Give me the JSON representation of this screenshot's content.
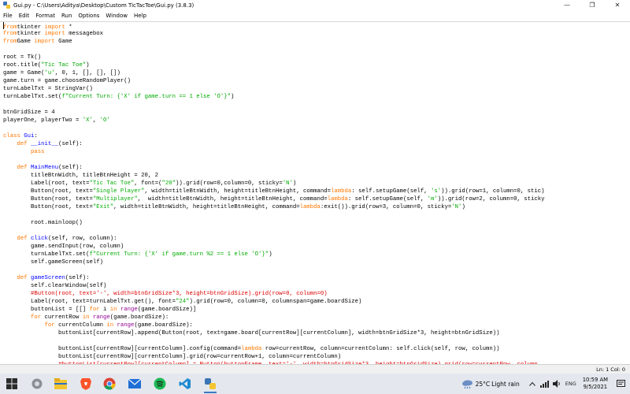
{
  "window": {
    "title": "Gui.py - C:\\Users\\Aditya\\Desktop\\Custom TicTacToe\\Gui.py (3.8.3)",
    "controls": {
      "minimize": "—",
      "maximize": "❐",
      "close": "✕"
    }
  },
  "menu": [
    "File",
    "Edit",
    "Format",
    "Run",
    "Options",
    "Window",
    "Help"
  ],
  "code_lines": [
    [
      [
        "kw",
        "from"
      ],
      [
        "",
        "tkinter "
      ],
      [
        "kw",
        "import"
      ],
      [
        "",
        " *"
      ]
    ],
    [
      [
        "kw",
        "from"
      ],
      [
        "",
        "tkinter "
      ],
      [
        "kw",
        "import"
      ],
      [
        "",
        " messagebox"
      ]
    ],
    [
      [
        "kw",
        "from"
      ],
      [
        "",
        "Game "
      ],
      [
        "kw",
        "import"
      ],
      [
        "",
        " Game"
      ]
    ],
    [],
    [
      [
        "",
        "root = Tk()"
      ]
    ],
    [
      [
        "",
        "root.title("
      ],
      [
        "str",
        "\"Tic Tac Toe\""
      ],
      [
        "",
        ")"
      ]
    ],
    [
      [
        "",
        "game = Game("
      ],
      [
        "str",
        "'u'"
      ],
      [
        "",
        ", 0, 1, [], [], [])"
      ]
    ],
    [
      [
        "",
        "game.turn = game.chooseRandomPlayer()"
      ]
    ],
    [
      [
        "",
        "turnLabelTxt = StringVar()"
      ]
    ],
    [
      [
        "",
        "turnLabelTxt.set("
      ],
      [
        "str",
        "f\"Current Turn: {'X' if game.turn == 1 else 'O'}\""
      ],
      [
        "",
        ")"
      ]
    ],
    [],
    [
      [
        "",
        "btnGridSize = 4"
      ]
    ],
    [
      [
        "",
        "playerOne, playerTwo = "
      ],
      [
        "str",
        "'X'"
      ],
      [
        "",
        ", "
      ],
      [
        "str",
        "'O'"
      ]
    ],
    [],
    [
      [
        "kw",
        "class"
      ],
      [
        "",
        " "
      ],
      [
        "def",
        "Gui"
      ],
      [
        "",
        ":"
      ]
    ],
    [
      [
        "",
        "    "
      ],
      [
        "kw",
        "def"
      ],
      [
        "",
        " "
      ],
      [
        "def",
        "__init__"
      ],
      [
        "",
        "(self):"
      ]
    ],
    [
      [
        "",
        "        "
      ],
      [
        "kw",
        "pass"
      ]
    ],
    [],
    [
      [
        "",
        "    "
      ],
      [
        "kw",
        "def"
      ],
      [
        "",
        " "
      ],
      [
        "def",
        "MainMenu"
      ],
      [
        "",
        "(self):"
      ]
    ],
    [
      [
        "",
        "        titleBtnWidth, titleBtnHeight = 20, 2"
      ]
    ],
    [
      [
        "",
        "        Label(root, text="
      ],
      [
        "str",
        "\"Tic Tac Toe\""
      ],
      [
        "",
        ", font=("
      ],
      [
        "str",
        "\"20\""
      ],
      [
        "",
        ")).grid(row=0,column=0, sticky="
      ],
      [
        "str",
        "'N'"
      ],
      [
        "",
        ")"
      ]
    ],
    [
      [
        "",
        "        Button(root, text="
      ],
      [
        "str",
        "\"Single Player\""
      ],
      [
        "",
        ", width=titleBtnWidth, height=titleBtnHeight, command="
      ],
      [
        "kw",
        "lambda"
      ],
      [
        "",
        ": self.setupGame(self, "
      ],
      [
        "str",
        "'s'"
      ],
      [
        "",
        "))"
      ],
      [
        "",
        ".grid(row=1, column=0, stic)"
      ]
    ],
    [
      [
        "",
        "        Button(root, text="
      ],
      [
        "str",
        "\"Multiplayer\""
      ],
      [
        "",
        ",  width=titleBtnWidth, height=titleBtnHeight, command="
      ],
      [
        "kw",
        "lambda"
      ],
      [
        "",
        ": self.setupGame(self, "
      ],
      [
        "str",
        "'m'"
      ],
      [
        "",
        ")).grid(row=2, column=0, sticky"
      ]
    ],
    [
      [
        "",
        "        Button(root, text="
      ],
      [
        "str",
        "\"Exit\""
      ],
      [
        "",
        ", width=titleBtnWidth, height=titleBtnHeight, command="
      ],
      [
        "kw",
        "lambda"
      ],
      [
        "",
        ":exit()).grid(row=3, column=0, sticky="
      ],
      [
        "str",
        "'N'"
      ],
      [
        "",
        ")"
      ]
    ],
    [],
    [
      [
        "",
        "        root.mainloop()"
      ]
    ],
    [],
    [
      [
        "",
        "    "
      ],
      [
        "kw",
        "def"
      ],
      [
        "",
        " "
      ],
      [
        "def",
        "click"
      ],
      [
        "",
        "(self, row, column):"
      ]
    ],
    [
      [
        "",
        "        game.sendInput(row, column)"
      ]
    ],
    [
      [
        "",
        "        turnLabelTxt.set("
      ],
      [
        "str",
        "f\"Current Turn: {'X' if game.turn %2 == 1 else 'O'}\""
      ],
      [
        "",
        ")"
      ]
    ],
    [
      [
        "",
        "        self.gameScreen(self)"
      ]
    ],
    [],
    [
      [
        "",
        "    "
      ],
      [
        "kw",
        "def"
      ],
      [
        "",
        " "
      ],
      [
        "def",
        "gameScreen"
      ],
      [
        "",
        "(self):"
      ]
    ],
    [
      [
        "",
        "        self.clearWindow(self)"
      ]
    ],
    [
      [
        "",
        "        "
      ],
      [
        "cm",
        "#Button(root, text='-', width=btnGridSize*3, height=btnGridSize).grid(row=0, column=0)"
      ]
    ],
    [
      [
        "",
        "        Label(root, text=turnLabelTxt.get(), font="
      ],
      [
        "str",
        "\"24\""
      ],
      [
        "",
        ").grid(row=0, column=0, columnspan=game.boardSize)"
      ]
    ],
    [
      [
        "",
        "        buttonList = [[] "
      ],
      [
        "kw",
        "for"
      ],
      [
        "",
        " i "
      ],
      [
        "kw",
        "in"
      ],
      [
        "",
        " "
      ],
      [
        "bi",
        "range"
      ],
      [
        "",
        "(game.boardSize)]"
      ]
    ],
    [
      [
        "",
        "        "
      ],
      [
        "kw",
        "for"
      ],
      [
        "",
        " currentRow "
      ],
      [
        "kw",
        "in"
      ],
      [
        "",
        " "
      ],
      [
        "bi",
        "range"
      ],
      [
        "",
        "(game.boardSize):"
      ]
    ],
    [
      [
        "",
        "            "
      ],
      [
        "kw",
        "for"
      ],
      [
        "",
        " currentColumn "
      ],
      [
        "kw",
        "in"
      ],
      [
        "",
        " "
      ],
      [
        "bi",
        "range"
      ],
      [
        "",
        "(game.boardSize):"
      ]
    ],
    [
      [
        "",
        "                buttonList[currentRow].append(Button(root, text=game.board[currentRow][currentColumn], width=btnGridSize*3, height=btnGridSize))"
      ]
    ],
    [],
    [
      [
        "",
        "                buttonList[currentRow][currentColumn].config(command="
      ],
      [
        "kw",
        "lambda"
      ],
      [
        "",
        " row=currentRow, column=currentColumn: self.click(self, row, column))"
      ]
    ],
    [
      [
        "",
        "                buttonList[currentRow][currentColumn].grid(row=currentRow+1, column=currentColumn)"
      ]
    ],
    [
      [
        "",
        "                "
      ],
      [
        "cm",
        "#buttonList[currentRow][currentColumn] = Button(buttonFrame, text='-', width=btnGridSize*3, height=btnGridSize).grid(row=currentRow, column"
      ]
    ]
  ],
  "status": {
    "line_col": "Ln: 1   Col: 0"
  },
  "taskbar": {
    "weather": {
      "temp": "25°C",
      "condition": "Light rain"
    },
    "language": "ENG",
    "time": "10:59 AM",
    "date": "9/5/2021"
  }
}
